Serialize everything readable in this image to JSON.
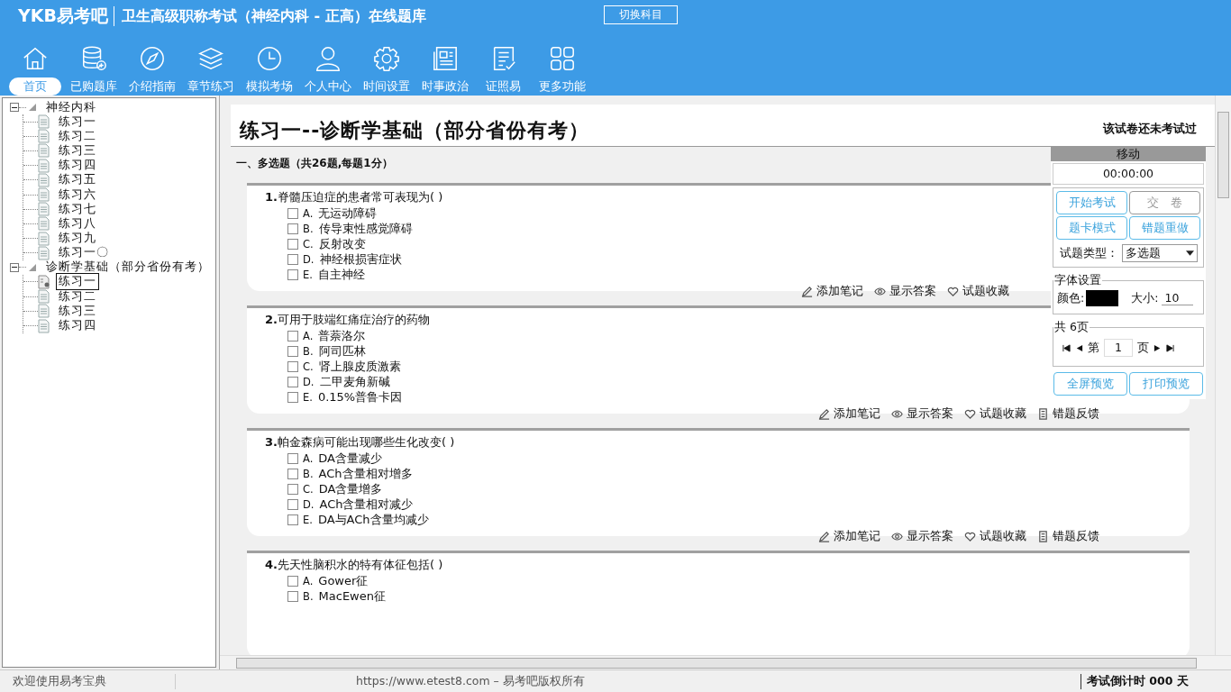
{
  "header": {
    "logo": "YKB易考吧",
    "title": "卫生高级职称考试（神经内科 - 正高）在线题库",
    "switch_button": "切换科目"
  },
  "nav": [
    {
      "label": "首页",
      "selected": true
    },
    {
      "label": "已购题库",
      "selected": false
    },
    {
      "label": "介绍指南",
      "selected": false
    },
    {
      "label": "章节练习",
      "selected": false
    },
    {
      "label": "模拟考场",
      "selected": false
    },
    {
      "label": "个人中心",
      "selected": false
    },
    {
      "label": "时间设置",
      "selected": false
    },
    {
      "label": "时事政治",
      "selected": false
    },
    {
      "label": "证照易",
      "selected": false
    },
    {
      "label": "更多功能",
      "selected": false
    }
  ],
  "tree": [
    {
      "label": "神经内科",
      "expanded": true,
      "children": [
        {
          "label": "练习一",
          "selected": false
        },
        {
          "label": "练习二",
          "selected": false
        },
        {
          "label": "练习三",
          "selected": false
        },
        {
          "label": "练习四",
          "selected": false
        },
        {
          "label": "练习五",
          "selected": false
        },
        {
          "label": "练习六",
          "selected": false
        },
        {
          "label": "练习七",
          "selected": false
        },
        {
          "label": "练习八",
          "selected": false
        },
        {
          "label": "练习九",
          "selected": false
        },
        {
          "label": "练习一〇",
          "selected": false
        }
      ]
    },
    {
      "label": "诊断学基础（部分省份有考）",
      "expanded": true,
      "children": [
        {
          "label": "练习一",
          "selected": true
        },
        {
          "label": "练习二",
          "selected": false
        },
        {
          "label": "练习三",
          "selected": false
        },
        {
          "label": "练习四",
          "selected": false
        }
      ]
    }
  ],
  "paper": {
    "title": "练习一--诊断学基础（部分省份有考）",
    "status": "该试卷还未考试过",
    "section": "一、多选题（共26题,每题1分）"
  },
  "questions": [
    {
      "number": "1.",
      "text": "脊髓压迫症的患者常可表现为( )",
      "options": [
        {
          "letter": "A.",
          "text": "无运动障碍",
          "checked": false
        },
        {
          "letter": "B.",
          "text": "传导束性感觉障碍",
          "checked": false
        },
        {
          "letter": "C.",
          "text": "反射改变",
          "checked": false
        },
        {
          "letter": "D.",
          "text": "神经根损害症状",
          "checked": false
        },
        {
          "letter": "E.",
          "text": "自主神经",
          "checked": false
        }
      ],
      "actions": [
        "添加笔记",
        "显示答案",
        "试题收藏"
      ]
    },
    {
      "number": "2.",
      "text": "可用于肢端红痛症治疗的药物",
      "options": [
        {
          "letter": "A.",
          "text": "普萘洛尔",
          "checked": false
        },
        {
          "letter": "B.",
          "text": "阿司匹林",
          "checked": false
        },
        {
          "letter": "C.",
          "text": "肾上腺皮质激素",
          "checked": false
        },
        {
          "letter": "D.",
          "text": "二甲麦角新碱",
          "checked": false
        },
        {
          "letter": "E.",
          "text": "0.15%普鲁卡因",
          "checked": false
        }
      ],
      "actions": [
        "添加笔记",
        "显示答案",
        "试题收藏",
        "错题反馈"
      ]
    },
    {
      "number": "3.",
      "text": "帕金森病可能出现哪些生化改变( )",
      "options": [
        {
          "letter": "A.",
          "text": "DA含量减少",
          "checked": false
        },
        {
          "letter": "B.",
          "text": "ACh含量相对增多",
          "checked": false
        },
        {
          "letter": "C.",
          "text": "DA含量增多",
          "checked": false
        },
        {
          "letter": "D.",
          "text": "ACh含量相对减少",
          "checked": false
        },
        {
          "letter": "E.",
          "text": "DA与ACh含量均减少",
          "checked": false
        }
      ],
      "actions": [
        "添加笔记",
        "显示答案",
        "试题收藏",
        "错题反馈"
      ]
    },
    {
      "number": "4.",
      "text": "先天性脑积水的特有体征包括( )",
      "options": [
        {
          "letter": "A.",
          "text": "Gower征",
          "checked": false
        },
        {
          "letter": "B.",
          "text": "MacEwen征",
          "checked": false
        }
      ]
    }
  ],
  "panel": {
    "header": "移动",
    "timer": "00:00:00",
    "buttons": [
      {
        "label": "开始考试",
        "disabled": false
      },
      {
        "label": "交　卷",
        "disabled": true
      },
      {
        "label": "题卡模式",
        "disabled": false
      },
      {
        "label": "错题重做",
        "disabled": false
      }
    ],
    "type_label": "试题类型：",
    "type_value": "多选题",
    "font_legend": "字体设置",
    "color_label": "颜色:",
    "color": "#000000",
    "size_label": "大小:",
    "size_value": "10",
    "pages_legend": "共 6页",
    "page_prefix": "第",
    "page_value": "1",
    "page_suffix": "页",
    "bottom_buttons": [
      "全屏预览",
      "打印预览"
    ]
  },
  "status_bar": {
    "welcome": "欢迎使用易考宝典",
    "copyright": "https://www.etest8.com – 易考吧版权所有",
    "countdown": "考试倒计时 000 天"
  }
}
